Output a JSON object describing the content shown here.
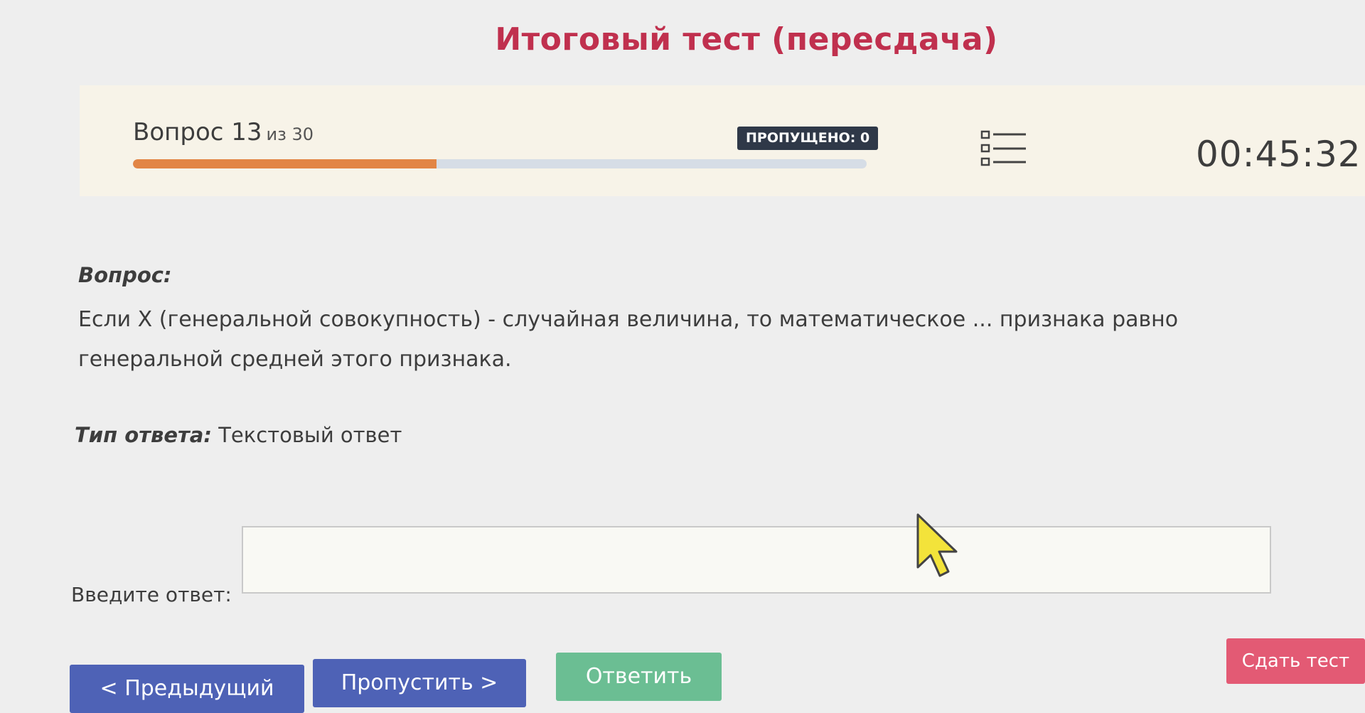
{
  "page": {
    "title": "Итоговый тест (пересдача)"
  },
  "header": {
    "question_word": "Вопрос",
    "question_number": "13",
    "question_total_text": "из 30",
    "progress_fraction": 0.4138,
    "skipped_label": "ПРОПУЩЕНО: 0",
    "list_icon": "question-list-icon",
    "timer": "00:45:32"
  },
  "question": {
    "label": "Вопрос:",
    "text": "Если X (генеральной совокупность) - случайная величина, то математическое ... признака равно генеральной средней этого признака."
  },
  "answer_type": {
    "key": "Тип ответа:",
    "value": "Текстовый ответ"
  },
  "answer": {
    "label": "Введите ответ:",
    "value": "",
    "placeholder": ""
  },
  "buttons": {
    "previous": "< Предыдущий",
    "skip": "Пропустить >",
    "answer": "Ответить",
    "submit": "Сдать тест"
  },
  "colors": {
    "title": "#c0304e",
    "progress": "#e28545",
    "nav_buttons": "#4e62b6",
    "answer_button": "#6bbe93",
    "submit_button": "#e35a74"
  }
}
